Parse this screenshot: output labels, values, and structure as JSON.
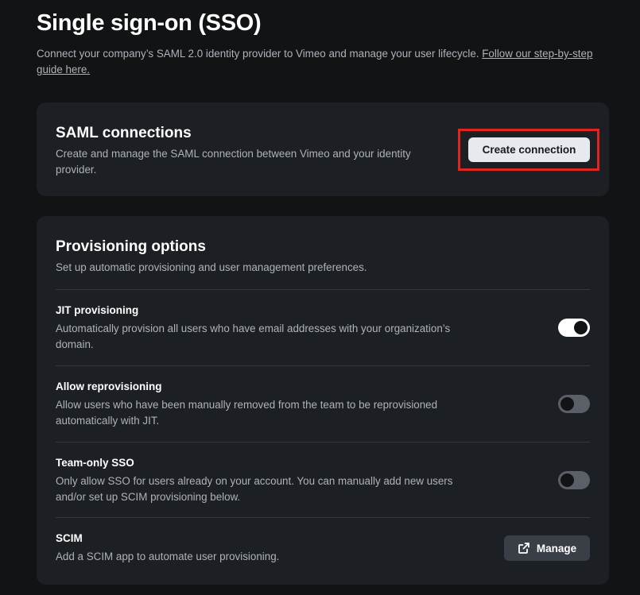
{
  "header": {
    "title": "Single sign-on (SSO)",
    "description": "Connect your company’s SAML 2.0 identity provider to Vimeo and manage your user lifecycle.",
    "guide_link": "Follow our step-by-step guide here."
  },
  "saml": {
    "title": "SAML connections",
    "description": "Create and manage the SAML connection between Vimeo and your identity provider.",
    "create_button": "Create connection"
  },
  "provisioning": {
    "title": "Provisioning options",
    "description": "Set up automatic provisioning and user management preferences.",
    "jit": {
      "title": "JIT provisioning",
      "description": "Automatically provision all users who have email addresses with your organization’s domain.",
      "enabled": true
    },
    "reprovisioning": {
      "title": "Allow reprovisioning",
      "description": "Allow users who have been manually removed from the team to be reprovisioned automatically with JIT.",
      "enabled": false
    },
    "team_only": {
      "title": "Team-only SSO",
      "description": "Only allow SSO for users already on your account. You can manually add new users and/or set up SCIM provisioning below.",
      "enabled": false
    },
    "scim": {
      "title": "SCIM",
      "description": "Add a SCIM app to automate user provisioning.",
      "manage_button": "Manage",
      "manage_icon": "external-link-icon"
    }
  },
  "colors": {
    "background": "#111315",
    "card": "#1c1f24",
    "highlight": "#e0251f",
    "toggle_on": "#ffffff",
    "toggle_off": "#5a5f68"
  }
}
